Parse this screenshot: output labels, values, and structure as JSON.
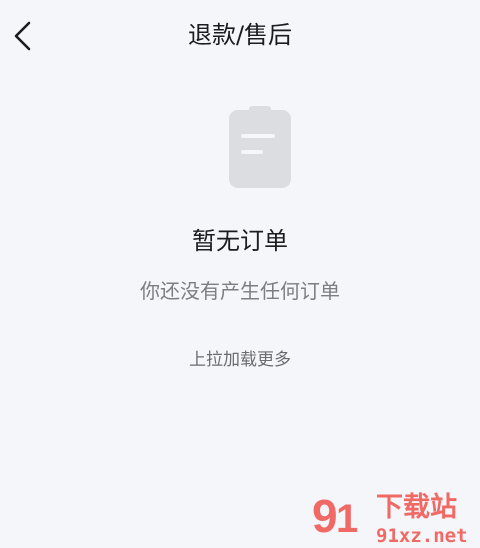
{
  "header": {
    "title": "退款/售后",
    "back_icon": "chevron-left-icon"
  },
  "empty_state": {
    "icon": "clipboard-icon",
    "title": "暂无订单",
    "subtitle": "你还没有产生任何订单",
    "load_more": "上拉加载更多"
  },
  "watermark": {
    "text_cn": "下载站",
    "text_url": "91xz.net",
    "color": "#f05a55"
  },
  "colors": {
    "background": "#f5f6fa",
    "icon_gray": "#dcdde1"
  }
}
